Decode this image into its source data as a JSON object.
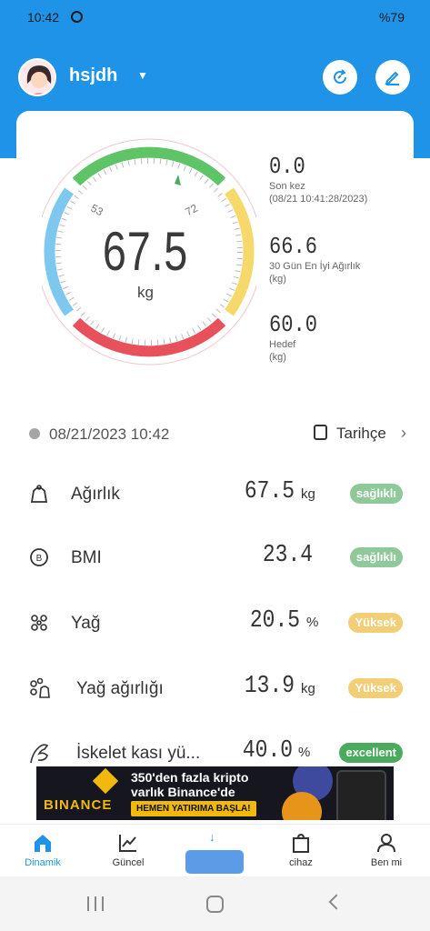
{
  "status_bar": {
    "time": "10:42",
    "battery": "%79"
  },
  "header": {
    "username": "hsjdh",
    "refresh_icon": "refresh-icon",
    "edit_icon": "edit-icon"
  },
  "gauge": {
    "value": "67.5",
    "unit": "kg",
    "tick_left": "53",
    "tick_right": "72"
  },
  "stats": {
    "last": {
      "value": "0.0",
      "label": "Son kez",
      "sublabel": "(08/21 10:41:28/2023)"
    },
    "best30": {
      "value": "66.6",
      "label": "30 Gün En İyi Ağırlık",
      "sublabel": "(kg)"
    },
    "target": {
      "value": "60.0",
      "label": "Hedef",
      "sublabel": "(kg)"
    }
  },
  "record": {
    "datetime": "08/21/2023 10:42",
    "history_label": "Tarihçe"
  },
  "metrics": [
    {
      "name": "Ağırlık",
      "value": "67.5",
      "unit": "kg",
      "badge": "sağlıklı",
      "badge_color": "#8fc99a"
    },
    {
      "name": "BMI",
      "value": "23.4",
      "unit": "",
      "badge": "sağlıklı",
      "badge_color": "#8fc99a"
    },
    {
      "name": "Yağ",
      "value": "20.5",
      "unit": "%",
      "badge": "Yüksek",
      "badge_color": "#f2cf76"
    },
    {
      "name": "Yağ ağırlığı",
      "value": "13.9",
      "unit": "kg",
      "badge": "Yüksek",
      "badge_color": "#f2cf76"
    },
    {
      "name": "İskelet kası yü...",
      "value": "40.0",
      "unit": "%",
      "badge": "excellent",
      "badge_color": "#4aab5c"
    }
  ],
  "ad": {
    "brand": "BINANCE",
    "line1": "350'den fazla kripto",
    "line2": "varlık Binance'de",
    "cta": "HEMEN YATIRIMA BAŞLA!"
  },
  "tabs": [
    {
      "label": "Dinamik",
      "icon": "home-icon"
    },
    {
      "label": "Güncel",
      "icon": "chart-icon"
    },
    {
      "label": "cihaz",
      "icon": "bag-icon"
    },
    {
      "label": "Ben mi",
      "icon": "person-icon"
    }
  ],
  "colors": {
    "primary": "#1f93e8",
    "gauge_green": "#5fc466",
    "gauge_yellow": "#f7d86a",
    "gauge_red": "#e8505b",
    "gauge_blue": "#7ec8f0"
  }
}
